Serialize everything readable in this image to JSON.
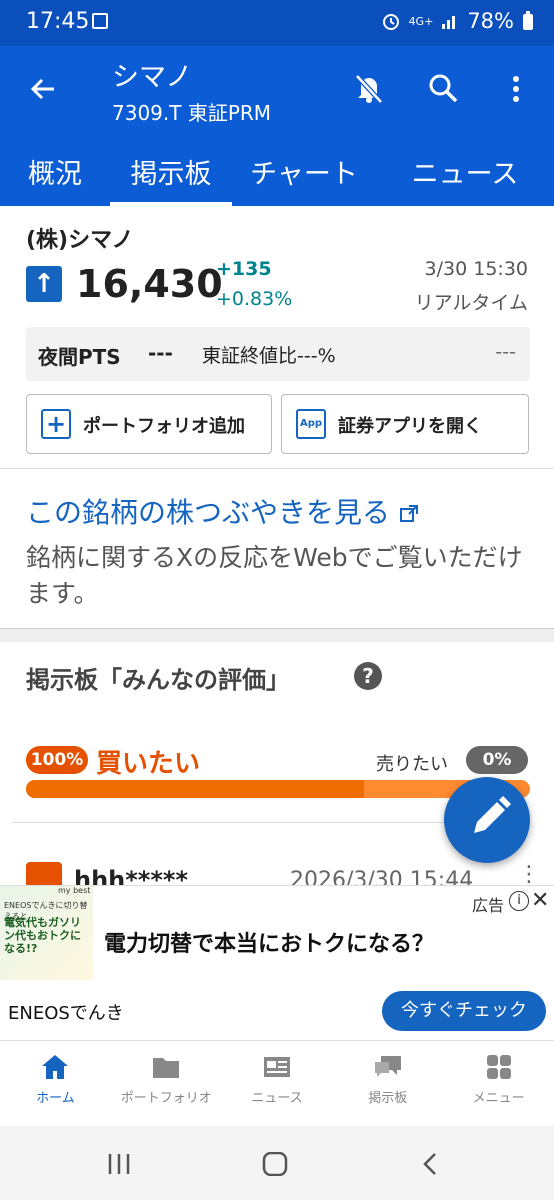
{
  "status_bar": {
    "time": "17:45",
    "network": "4G+",
    "battery": "78%"
  },
  "header": {
    "title": "シマノ",
    "subtitle": "7309.T 東証PRM"
  },
  "tabs": [
    {
      "label": "概況",
      "active": false
    },
    {
      "label": "掲示板",
      "active": true
    },
    {
      "label": "チャート",
      "active": false
    },
    {
      "label": "ニュース",
      "active": false
    }
  ],
  "stock": {
    "name": "(株)シマノ",
    "price": "16,430",
    "change": "+135",
    "change_pct": "+0.83%",
    "time": "3/30 15:30",
    "time_label": "リアルタイム"
  },
  "pts": {
    "label": "夜間PTS",
    "value": "---",
    "ratio": "東証終値比---%",
    "right": "---"
  },
  "buttons": {
    "portfolio": "ポートフォリオ追加",
    "open_app": "証券アプリを開く",
    "app_badge": "App"
  },
  "tsubuyaki": {
    "link": "この銘柄の株つぶやきを見る",
    "desc": "銘柄に関するXの反応をWebでご覧いただけます。"
  },
  "bbs": {
    "title": "掲示板「みんなの評価」",
    "help": "?",
    "buy_pct": "100%",
    "buy_label": "買いたい",
    "sell_label": "売りたい",
    "sell_pct": "0%",
    "buy_ratio": 0.67
  },
  "post": {
    "user": "hhh*****",
    "date": "2026/3/30 15:44"
  },
  "ad": {
    "label": "広告",
    "brand": "my best",
    "img_line1": "ENEOSでんきに切り替えると",
    "img_line2": "電気代もガソリン代もおトクになる!?",
    "headline": "電力切替で本当におトクになる？",
    "advertiser": "ENEOSでんき",
    "cta": "今すぐチェック"
  },
  "bottom_nav": [
    {
      "label": "ホーム",
      "active": true
    },
    {
      "label": "ポートフォリオ",
      "active": false
    },
    {
      "label": "ニュース",
      "active": false
    },
    {
      "label": "掲示板",
      "active": false
    },
    {
      "label": "メニュー",
      "active": false
    }
  ],
  "colors": {
    "primary": "#0b5cd5",
    "buy": "#e65100",
    "sell": "#ff8a30",
    "up": "#00838f"
  }
}
